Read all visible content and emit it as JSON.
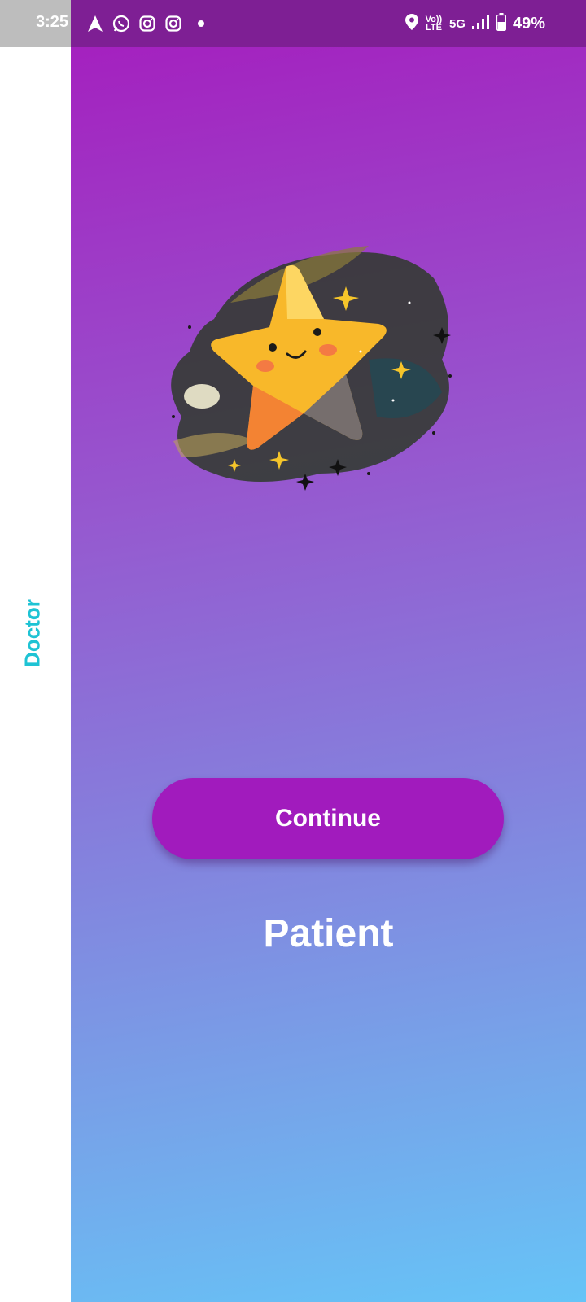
{
  "status_bar": {
    "time": "3:25",
    "left_icons": [
      "navigation-icon",
      "whatsapp-icon",
      "instagram-icon",
      "instagram-icon",
      "notification-dot-icon"
    ],
    "volte": "Vo)) LTE",
    "network": "5G",
    "battery": "49%"
  },
  "sidebar": {
    "label": "Doctor"
  },
  "main": {
    "illustration": "star-icon",
    "continue_label": "Continue",
    "role_label": "Patient"
  },
  "colors": {
    "status_bar": "#7e1f94",
    "gradient_top": "#a421bf",
    "gradient_bottom": "#66c4f7",
    "button": "#a11bbd",
    "sidebar_label": "#1ec3d4"
  }
}
